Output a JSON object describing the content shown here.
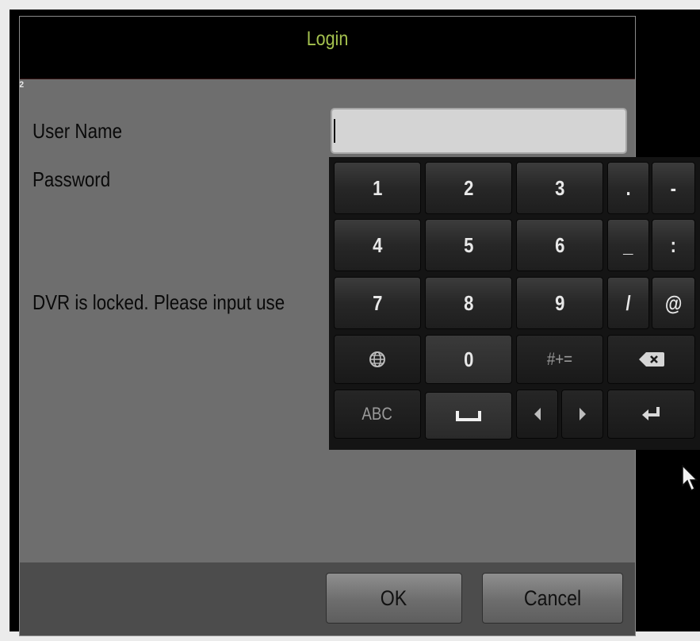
{
  "dialog": {
    "title": "Login",
    "edge_marker": "2",
    "username_label": "User Name",
    "password_label": "Password",
    "locked_message": "DVR is locked. Please input use",
    "username_value": "",
    "ok_label": "OK",
    "cancel_label": "Cancel"
  },
  "keyboard": {
    "row1": [
      "1",
      "2",
      "3",
      ".",
      "-"
    ],
    "row2": [
      "4",
      "5",
      "6",
      "_",
      ":"
    ],
    "row3": [
      "7",
      "8",
      "9",
      "/",
      "@"
    ],
    "row4": {
      "zero": "0",
      "symbols": "#+="
    },
    "row5": {
      "abc": "ABC"
    },
    "icons": [
      "globe-icon",
      "backspace-icon",
      "space-icon",
      "arrow-left-icon",
      "arrow-right-icon",
      "enter-icon"
    ]
  },
  "colors": {
    "title_green": "#a5c24f",
    "panel_gray": "#6e6e6e",
    "keyboard_bg": "#141414"
  }
}
